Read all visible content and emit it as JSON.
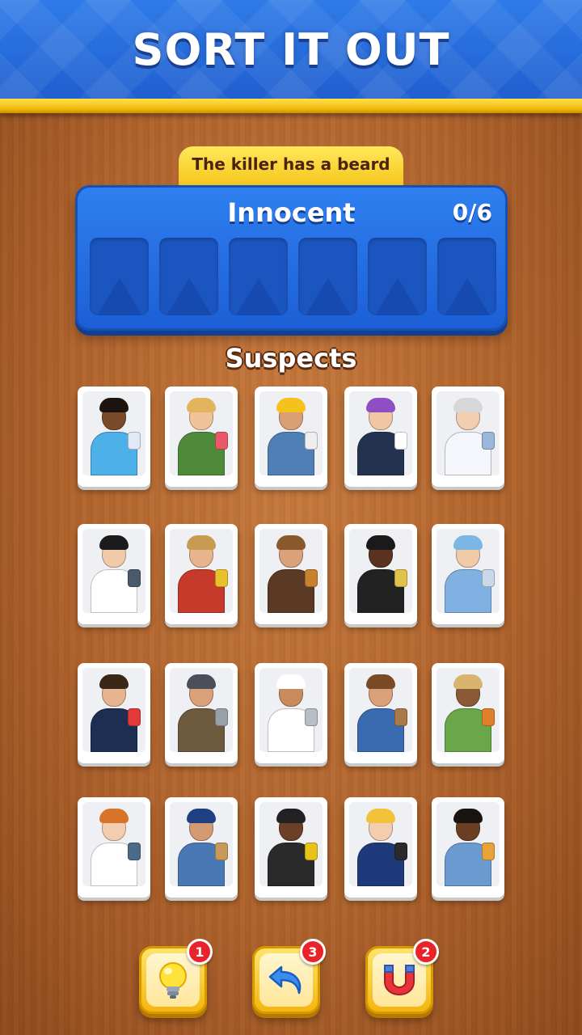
{
  "header": {
    "title": "SORT IT OUT"
  },
  "clue": {
    "text": "The killer has a beard"
  },
  "innocent_panel": {
    "title": "Innocent",
    "count": "0/6",
    "slots": 6
  },
  "suspects": {
    "label": "Suspects",
    "cards": [
      {
        "role": "athlete",
        "skin": "#7a4a2a",
        "hair": "#1d1410",
        "outfit": "#4db0e8",
        "prop": "#e0e9f5"
      },
      {
        "role": "florist",
        "skin": "#f0c39a",
        "hair": "#e2b45c",
        "outfit": "#4f8a3a",
        "prop": "#e85a6a"
      },
      {
        "role": "construction-worker",
        "skin": "#d9a074",
        "hair": "#f4c21a",
        "outfit": "#4f7fb4",
        "prop": "#eeeeee"
      },
      {
        "role": "paramedic",
        "skin": "#f1c6a4",
        "hair": "#8e4fc4",
        "outfit": "#23334f",
        "prop": "#ffffff"
      },
      {
        "role": "doctor",
        "skin": "#f3cdb0",
        "hair": "#d7d7d7",
        "outfit": "#f4f6fb",
        "prop": "#9ab7d9"
      },
      {
        "role": "nurse",
        "skin": "#f1cba8",
        "hair": "#1b1b1b",
        "outfit": "#ffffff",
        "prop": "#4a5a6a"
      },
      {
        "role": "farmer",
        "skin": "#e8b48c",
        "hair": "#c89a52",
        "outfit": "#c63a2c",
        "prop": "#e8c22a"
      },
      {
        "role": "musician",
        "skin": "#d9a07a",
        "hair": "#8a5a2c",
        "outfit": "#5a3a24",
        "prop": "#c8822e"
      },
      {
        "role": "security-guard",
        "skin": "#5a3320",
        "hair": "#1a1a1a",
        "outfit": "#222222",
        "prop": "#e2c24a"
      },
      {
        "role": "surgeon",
        "skin": "#f1cba8",
        "hair": "#7cb6e4",
        "outfit": "#7fb2e2",
        "prop": "#c8d8e8"
      },
      {
        "role": "emt",
        "skin": "#e6b48e",
        "hair": "#3a2718",
        "outfit": "#1e2e52",
        "prop": "#e23a3a"
      },
      {
        "role": "welder",
        "skin": "#d9a07a",
        "hair": "#4a4f5a",
        "outfit": "#6e5a3e",
        "prop": "#9aa0a8"
      },
      {
        "role": "chef",
        "skin": "#c98a5e",
        "hair": "#ffffff",
        "outfit": "#ffffff",
        "prop": "#b8bec6"
      },
      {
        "role": "cowboy",
        "skin": "#d9a07a",
        "hair": "#7a4a26",
        "outfit": "#3a6ab0",
        "prop": "#a87a4a"
      },
      {
        "role": "gardener",
        "skin": "#8a5a36",
        "hair": "#d8b46e",
        "outfit": "#6aa64a",
        "prop": "#e0802a"
      },
      {
        "role": "radiologist",
        "skin": "#f3cdb0",
        "hair": "#d8742a",
        "outfit": "#ffffff",
        "prop": "#4a6a8a"
      },
      {
        "role": "mail-carrier",
        "skin": "#d49a72",
        "hair": "#1f3f82",
        "outfit": "#4a78b4",
        "prop": "#c89a5a"
      },
      {
        "role": "firefighter",
        "skin": "#6a4028",
        "hair": "#222222",
        "outfit": "#2a2a2a",
        "prop": "#e8c21a"
      },
      {
        "role": "police-officer",
        "skin": "#f3cdb0",
        "hair": "#f2c23a",
        "outfit": "#1f3a7a",
        "prop": "#2a2a2a"
      },
      {
        "role": "painter",
        "skin": "#6a3e22",
        "hair": "#1a1410",
        "outfit": "#6a9ad0",
        "prop": "#e8a23a"
      }
    ]
  },
  "tools": [
    {
      "name": "hint",
      "icon": "lightbulb-icon",
      "count": "1"
    },
    {
      "name": "undo",
      "icon": "undo-arrow-icon",
      "count": "3"
    },
    {
      "name": "magnet",
      "icon": "magnet-icon",
      "count": "2"
    }
  ],
  "colors": {
    "header_blue": "#2a72e0",
    "panel_blue": "#2f7ff0",
    "tab_yellow": "#f5c418",
    "badge_red": "#e8242a",
    "wood": "#b0632c"
  }
}
